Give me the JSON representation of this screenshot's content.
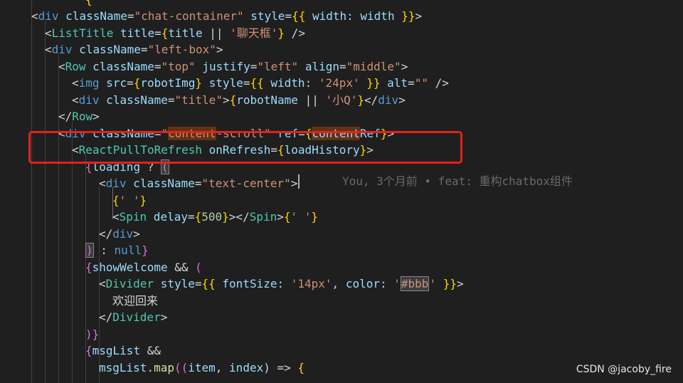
{
  "colors": {
    "background": "#1f1f1f",
    "tag": "#569cd6",
    "component": "#4ec9b0",
    "attribute": "#9cdcfe",
    "string": "#ce9178",
    "brace": "#ffd700",
    "brace_purple": "#da70d6",
    "plain": "#d4d4d4",
    "number": "#b5cea8",
    "keyword": "#569cd6",
    "function": "#dcdcaa",
    "blame": "#6a6a6a",
    "highlight_box": "#e8201a"
  },
  "blame_annotation": "You, 3个月前 • feat: 重构chatbox组件",
  "watermark": "CSDN @jacoby_fire",
  "lines": [
    [
      [
        "{",
        "brace"
      ]
    ],
    [
      [
        "<",
        "plain"
      ],
      [
        "div",
        "tag"
      ],
      [
        " className",
        "attribute"
      ],
      [
        "=",
        "plain"
      ],
      [
        "\"chat-container\"",
        "string"
      ],
      [
        " style",
        "attribute"
      ],
      [
        "=",
        "plain"
      ],
      [
        "{{",
        "brace"
      ],
      [
        " width: ",
        "attribute"
      ],
      [
        "width",
        "attribute"
      ],
      [
        " }}",
        "brace"
      ],
      [
        ">",
        "plain"
      ]
    ],
    [
      [
        "<",
        "plain"
      ],
      [
        "ListTitle",
        "component"
      ],
      [
        " title",
        "attribute"
      ],
      [
        "=",
        "plain"
      ],
      [
        "{",
        "brace"
      ],
      [
        "title",
        "attribute"
      ],
      [
        " || ",
        "plain"
      ],
      [
        "'聊天框'",
        "string"
      ],
      [
        "}",
        "brace"
      ],
      [
        " />",
        "plain"
      ]
    ],
    [
      [
        "<",
        "plain"
      ],
      [
        "div",
        "tag"
      ],
      [
        " className",
        "attribute"
      ],
      [
        "=",
        "plain"
      ],
      [
        "\"left-box\"",
        "string"
      ],
      [
        ">",
        "plain"
      ]
    ],
    [
      [
        "<",
        "plain"
      ],
      [
        "Row",
        "component"
      ],
      [
        " className",
        "attribute"
      ],
      [
        "=",
        "plain"
      ],
      [
        "\"top\"",
        "string"
      ],
      [
        " justify",
        "attribute"
      ],
      [
        "=",
        "plain"
      ],
      [
        "\"left\"",
        "string"
      ],
      [
        " align",
        "attribute"
      ],
      [
        "=",
        "plain"
      ],
      [
        "\"middle\"",
        "string"
      ],
      [
        ">",
        "plain"
      ]
    ],
    [
      [
        "<",
        "plain"
      ],
      [
        "img",
        "tag"
      ],
      [
        " src",
        "attribute"
      ],
      [
        "=",
        "plain"
      ],
      [
        "{",
        "brace"
      ],
      [
        "robotImg",
        "attribute"
      ],
      [
        "}",
        "brace"
      ],
      [
        " style",
        "attribute"
      ],
      [
        "=",
        "plain"
      ],
      [
        "{{",
        "brace"
      ],
      [
        " width: ",
        "attribute"
      ],
      [
        "'24px'",
        "string"
      ],
      [
        " }}",
        "brace"
      ],
      [
        " alt",
        "attribute"
      ],
      [
        "=",
        "plain"
      ],
      [
        "\"\"",
        "string"
      ],
      [
        " />",
        "plain"
      ]
    ],
    [
      [
        "<",
        "plain"
      ],
      [
        "div",
        "tag"
      ],
      [
        " className",
        "attribute"
      ],
      [
        "=",
        "plain"
      ],
      [
        "\"title\"",
        "string"
      ],
      [
        ">",
        "plain"
      ],
      [
        "{",
        "brace"
      ],
      [
        "robotName",
        "attribute"
      ],
      [
        " || ",
        "plain"
      ],
      [
        "'小Q'",
        "string"
      ],
      [
        "}",
        "brace"
      ],
      [
        "</",
        "plain"
      ],
      [
        "div",
        "tag"
      ],
      [
        ">",
        "plain"
      ]
    ],
    [
      [
        "</",
        "plain"
      ],
      [
        "Row",
        "component"
      ],
      [
        ">",
        "plain"
      ]
    ],
    [
      [
        "<",
        "plain"
      ],
      [
        "div",
        "tag"
      ],
      [
        " className",
        "attribute"
      ],
      [
        "=",
        "plain"
      ],
      [
        "\"",
        "string"
      ],
      [
        "content",
        "string_hl"
      ],
      [
        "-scroll\"",
        "string"
      ],
      [
        " ref",
        "attribute"
      ],
      [
        "=",
        "plain"
      ],
      [
        "{",
        "brace"
      ],
      [
        "content",
        "attribute_hl"
      ],
      [
        "Ref",
        "attribute"
      ],
      [
        "}",
        "brace"
      ],
      [
        ">",
        "plain"
      ]
    ],
    [
      [
        "<",
        "plain"
      ],
      [
        "ReactPullToRefresh",
        "component"
      ],
      [
        " onRefresh",
        "attribute"
      ],
      [
        "=",
        "plain"
      ],
      [
        "{",
        "brace"
      ],
      [
        "loadHistory",
        "attribute"
      ],
      [
        "}",
        "brace"
      ],
      [
        ">",
        "plain"
      ]
    ],
    [
      [
        "{",
        "brace_purple"
      ],
      [
        "loading",
        "attribute"
      ],
      [
        " ? ",
        "plain"
      ],
      [
        "(",
        "brace_box"
      ]
    ],
    [
      [
        "<",
        "plain"
      ],
      [
        "div",
        "tag"
      ],
      [
        " className",
        "attribute"
      ],
      [
        "=",
        "plain"
      ],
      [
        "\"text-center\"",
        "string"
      ],
      [
        ">",
        "plain"
      ]
    ],
    [
      [
        "{",
        "brace"
      ],
      [
        "' '",
        "string"
      ],
      [
        "}",
        "brace"
      ]
    ],
    [
      [
        "<",
        "plain"
      ],
      [
        "Spin",
        "component"
      ],
      [
        " delay",
        "attribute"
      ],
      [
        "=",
        "plain"
      ],
      [
        "{",
        "brace"
      ],
      [
        "500",
        "number"
      ],
      [
        "}",
        "brace"
      ],
      [
        "></",
        "plain"
      ],
      [
        "Spin",
        "component"
      ],
      [
        ">",
        "plain"
      ],
      [
        "{",
        "brace"
      ],
      [
        "' '",
        "string"
      ],
      [
        "}",
        "brace"
      ]
    ],
    [
      [
        "</",
        "plain"
      ],
      [
        "div",
        "tag"
      ],
      [
        ">",
        "plain"
      ]
    ],
    [
      [
        ")",
        "brace_box"
      ],
      [
        " : ",
        "plain"
      ],
      [
        "null",
        "keyword"
      ],
      [
        "}",
        "brace_purple"
      ]
    ],
    [
      [
        "{",
        "brace_purple"
      ],
      [
        "showWelcome",
        "attribute"
      ],
      [
        " && ",
        "plain"
      ],
      [
        "(",
        "brace_purple"
      ]
    ],
    [
      [
        "<",
        "plain"
      ],
      [
        "Divider",
        "component"
      ],
      [
        " style",
        "attribute"
      ],
      [
        "=",
        "plain"
      ],
      [
        "{{",
        "brace"
      ],
      [
        " fontSize: ",
        "attribute"
      ],
      [
        "'14px'",
        "string"
      ],
      [
        ", color: ",
        "attribute"
      ],
      [
        "'",
        "string"
      ],
      [
        "#bbb",
        "string_box"
      ],
      [
        "'",
        "string"
      ],
      [
        " }}",
        "brace"
      ],
      [
        ">",
        "plain"
      ]
    ],
    [
      [
        "欢迎回来",
        "plain"
      ]
    ],
    [
      [
        "</",
        "plain"
      ],
      [
        "Divider",
        "component"
      ],
      [
        ">",
        "plain"
      ]
    ],
    [
      [
        ")",
        "brace_purple"
      ],
      [
        "}",
        "brace_purple"
      ]
    ],
    [
      [
        "{",
        "brace_purple"
      ],
      [
        "msgList",
        "attribute"
      ],
      [
        " &&",
        "plain"
      ]
    ],
    [
      [
        "msgList",
        "attribute"
      ],
      [
        ".",
        "plain"
      ],
      [
        "map",
        "function"
      ],
      [
        "((",
        "brace_purple"
      ],
      [
        "item",
        "attribute"
      ],
      [
        ", ",
        "plain"
      ],
      [
        "index",
        "attribute"
      ],
      [
        ") => ",
        "plain"
      ],
      [
        "{",
        "brace"
      ]
    ]
  ]
}
